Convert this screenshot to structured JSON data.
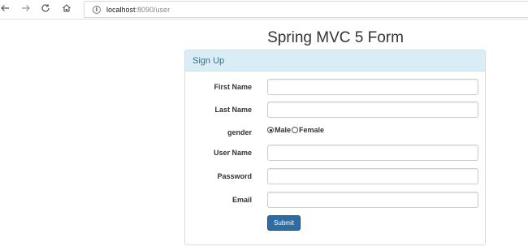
{
  "browser": {
    "back_icon": "back-arrow-icon",
    "forward_icon": "forward-arrow-icon",
    "reload_icon": "reload-icon",
    "home_icon": "home-icon",
    "url_host": "localhost",
    "url_rest": ":8090/user"
  },
  "page": {
    "title": "Spring MVC 5 Form"
  },
  "panel": {
    "heading": "Sign Up",
    "fields": {
      "first_name": {
        "label": "First Name",
        "value": ""
      },
      "last_name": {
        "label": "Last Name",
        "value": ""
      },
      "gender": {
        "label": "gender",
        "options": [
          "Male",
          "Female"
        ],
        "selected": "Male"
      },
      "user_name": {
        "label": "User Name",
        "value": ""
      },
      "password": {
        "label": "Password",
        "value": ""
      },
      "email": {
        "label": "Email",
        "value": ""
      }
    },
    "submit_label": "Submit"
  },
  "colors": {
    "panel_heading_bg": "#d9edf7",
    "panel_border": "#bce8f1",
    "panel_heading_text": "#31708f",
    "primary_button": "#2e6da4"
  }
}
